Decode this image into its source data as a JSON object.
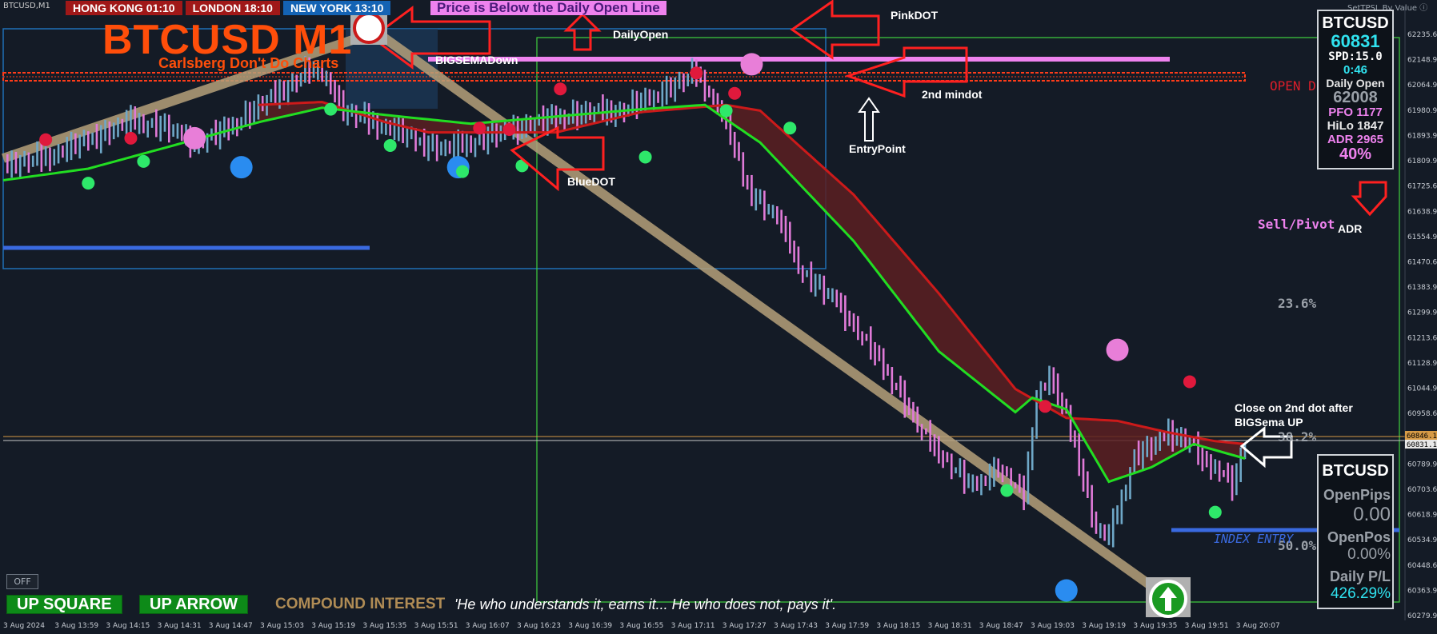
{
  "window": {
    "symbol_tag": "BTCUSD,M1",
    "topright_tag": "SetTPSL By Value ⓘ"
  },
  "sessions": [
    {
      "label": "HONG KONG 01:10"
    },
    {
      "label": "LONDON  18:10"
    },
    {
      "label": "NEW YORK 13:10"
    }
  ],
  "banner": "Price is Below the Daily Open Line",
  "title": "BTCUSD M1",
  "subtitle": "Carlsberg Don't Do Charts",
  "annotations": {
    "daily_open": "DailyOpen",
    "pink_dot": "PinkDOT",
    "big_sema_down": "BIGSEMADown",
    "second_mindot": "2nd mindot",
    "entry_point": "EntryPoint",
    "blue_dot": "BlueDOT",
    "open_d": "OPEN D",
    "sell_pivot": "Sell/Pivot",
    "adr": "ADR",
    "fib_236": "23.6%",
    "fib_382": "38.2%",
    "fib_500": "50.0%",
    "close_note_1": "Close on 2nd dot after",
    "close_note_2": "BIGSema UP",
    "index_entry": "INDEX ENTRY"
  },
  "info_panel": {
    "symbol": "BTCUSD",
    "price": "60831",
    "spread": "SPD:15.0",
    "timer": "0:46",
    "daily_open_label": "Daily Open",
    "daily_open_value": "62008",
    "pfo": "PFO 1177",
    "hilo": "HiLo 1847",
    "adr": "ADR 2965",
    "pct": "40%"
  },
  "position_panel": {
    "symbol": "BTCUSD",
    "open_pips_label": "OpenPips",
    "open_pips_value": "0.00",
    "open_pos_label": "OpenPos",
    "open_pos_value": "0.00%",
    "daily_pl_label": "Daily P/L",
    "daily_pl_value": "426.29%"
  },
  "bottom": {
    "up_square": "UP SQUARE",
    "up_arrow": "UP ARROW",
    "compound": "COMPOUND INTEREST",
    "quote": "'He who understands it, earns it... He who does not, pays it'.",
    "off": "OFF"
  },
  "colors": {
    "background": "#141b26",
    "bull_bar": "#6fa8c8",
    "bear_bar": "#e07ad8",
    "fast_ma": "#22dd22",
    "slow_ma": "#cc1a1a",
    "ribbon": "#5a1f22",
    "daily_open_line": "#ee82ee",
    "trendline": "#b5a07a",
    "title": "#ff4e0a",
    "price_label_cyan": "#30e3f0"
  },
  "chart_data": {
    "type": "candlestick",
    "symbol": "BTCUSD",
    "timeframe": "M1",
    "x_ticks": [
      "3 Aug 2024",
      "3 Aug 13:59",
      "3 Aug 14:15",
      "3 Aug 14:31",
      "3 Aug 14:47",
      "3 Aug 15:03",
      "3 Aug 15:19",
      "3 Aug 15:35",
      "3 Aug 15:51",
      "3 Aug 16:07",
      "3 Aug 16:23",
      "3 Aug 16:39",
      "3 Aug 16:55",
      "3 Aug 17:11",
      "3 Aug 17:27",
      "3 Aug 17:43",
      "3 Aug 17:59",
      "3 Aug 18:15",
      "3 Aug 18:31",
      "3 Aug 18:47",
      "3 Aug 19:03",
      "3 Aug 19:19",
      "3 Aug 19:35",
      "3 Aug 19:51",
      "3 Aug 20:07"
    ],
    "y_ticks": [
      62235.6,
      62148.9,
      62064.9,
      61980.9,
      61893.9,
      61809.9,
      61725.6,
      61638.9,
      61554.9,
      61470.6,
      61383.9,
      61299.9,
      61213.6,
      61128.9,
      61044.9,
      60958.6,
      60873.9,
      60789.9,
      60703.6,
      60618.9,
      60534.9,
      60448.6,
      60363.9,
      60279.9
    ],
    "ylim": [
      60262,
      62256
    ],
    "price_labels": [
      {
        "value": 60846.14,
        "text": "60846.14",
        "color": "#ffb347"
      },
      {
        "value": 60831.14,
        "text": "60831.14",
        "color": "#ffffff"
      }
    ],
    "daily_open": 62008,
    "close_points": [
      [
        0,
        61800
      ],
      [
        10,
        61830
      ],
      [
        20,
        61890
      ],
      [
        30,
        61955
      ],
      [
        38,
        61935
      ],
      [
        45,
        61880
      ],
      [
        52,
        61920
      ],
      [
        60,
        62005
      ],
      [
        67,
        62075
      ],
      [
        72,
        62135
      ],
      [
        76,
        62105
      ],
      [
        80,
        61990
      ],
      [
        86,
        61955
      ],
      [
        92,
        61925
      ],
      [
        98,
        61880
      ],
      [
        104,
        61860
      ],
      [
        110,
        61880
      ],
      [
        117,
        61915
      ],
      [
        124,
        61945
      ],
      [
        131,
        61970
      ],
      [
        138,
        61985
      ],
      [
        145,
        61990
      ],
      [
        152,
        62030
      ],
      [
        158,
        62080
      ],
      [
        163,
        62120
      ],
      [
        166,
        62055
      ],
      [
        170,
        61950
      ],
      [
        175,
        61720
      ],
      [
        182,
        61620
      ],
      [
        188,
        61430
      ],
      [
        196,
        61330
      ],
      [
        203,
        61190
      ],
      [
        210,
        61040
      ],
      [
        216,
        60880
      ],
      [
        222,
        60780
      ],
      [
        228,
        60690
      ],
      [
        234,
        60760
      ],
      [
        240,
        60660
      ],
      [
        243,
        61010
      ],
      [
        246,
        61070
      ],
      [
        250,
        60940
      ],
      [
        254,
        60720
      ],
      [
        257,
        60545
      ],
      [
        260,
        60520
      ],
      [
        263,
        60650
      ],
      [
        266,
        60800
      ],
      [
        270,
        60830
      ],
      [
        274,
        60880
      ],
      [
        279,
        60850
      ],
      [
        283,
        60760
      ],
      [
        286,
        60760
      ],
      [
        289,
        60700
      ],
      [
        292,
        60831
      ]
    ],
    "fast_ma_points": [
      [
        0,
        61750
      ],
      [
        20,
        61790
      ],
      [
        40,
        61870
      ],
      [
        60,
        61950
      ],
      [
        75,
        62000
      ],
      [
        90,
        61975
      ],
      [
        110,
        61945
      ],
      [
        130,
        61970
      ],
      [
        150,
        61995
      ],
      [
        165,
        62010
      ],
      [
        178,
        61880
      ],
      [
        200,
        61540
      ],
      [
        220,
        61160
      ],
      [
        238,
        60950
      ],
      [
        242,
        61000
      ],
      [
        250,
        60960
      ],
      [
        260,
        60710
      ],
      [
        270,
        60760
      ],
      [
        280,
        60840
      ],
      [
        292,
        60790
      ]
    ],
    "slow_ma_points": [
      [
        60,
        62010
      ],
      [
        75,
        62020
      ],
      [
        90,
        61950
      ],
      [
        100,
        61915
      ],
      [
        130,
        61915
      ],
      [
        150,
        61985
      ],
      [
        170,
        62010
      ],
      [
        178,
        61990
      ],
      [
        200,
        61700
      ],
      [
        220,
        61360
      ],
      [
        238,
        61030
      ],
      [
        250,
        60930
      ],
      [
        262,
        60920
      ],
      [
        274,
        60880
      ],
      [
        285,
        60850
      ],
      [
        292,
        60840
      ]
    ],
    "pink_dots": [
      [
        45,
        61895
      ],
      [
        176,
        62150
      ],
      [
        262,
        61165
      ]
    ],
    "blue_dots": [
      [
        56,
        61795
      ],
      [
        107,
        61795
      ],
      [
        250,
        60335
      ]
    ],
    "red_dots": [
      [
        10,
        61890
      ],
      [
        30,
        61895
      ],
      [
        131,
        62065
      ],
      [
        112,
        61930
      ],
      [
        119,
        61925
      ],
      [
        163,
        62120
      ],
      [
        172,
        62050
      ],
      [
        245,
        60970
      ],
      [
        279,
        61055
      ]
    ],
    "green_dots": [
      [
        20,
        61740
      ],
      [
        33,
        61815
      ],
      [
        77,
        61995
      ],
      [
        91,
        61870
      ],
      [
        108,
        61780
      ],
      [
        122,
        61800
      ],
      [
        151,
        61830
      ],
      [
        170,
        61990
      ],
      [
        185,
        61930
      ],
      [
        236,
        60680
      ],
      [
        285,
        60605
      ]
    ]
  }
}
